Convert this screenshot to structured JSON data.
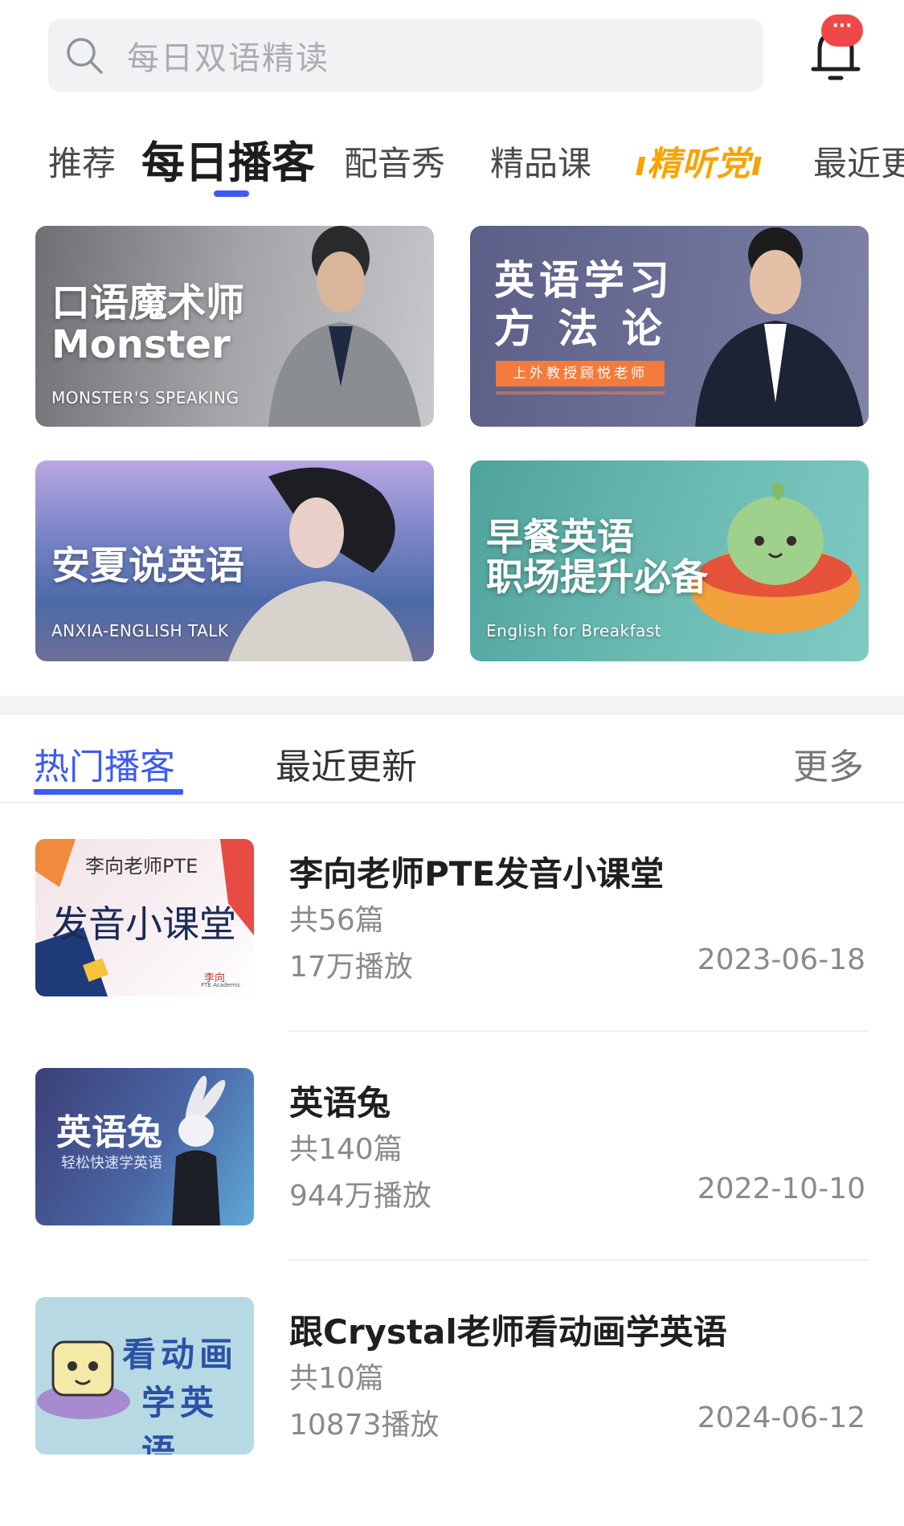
{
  "search": {
    "placeholder": "每日双语精读"
  },
  "notifications": {
    "badge": "···"
  },
  "category_tabs": [
    {
      "label": "推荐",
      "active": false
    },
    {
      "label": "每日播客",
      "active": true
    },
    {
      "label": "配音秀",
      "active": false
    },
    {
      "label": "精品课",
      "active": false
    },
    {
      "label": "精听党",
      "active": false
    },
    {
      "label": "最近更",
      "active": false
    }
  ],
  "banners": [
    {
      "title_line1": "口语魔术师",
      "title_line2": "Monster",
      "subtitle": "MONSTER'S SPEAKING"
    },
    {
      "title_line1": "英语学习",
      "title_line2": "方 法 论",
      "tag": "上外教授顾悦老师"
    },
    {
      "title_line1": "安夏说英语",
      "subtitle": "ANXIA-ENGLISH TALK"
    },
    {
      "title_line1": "早餐英语",
      "title_line2": "职场提升必备",
      "subtitle": "English for Breakfast"
    }
  ],
  "list_tabs": {
    "hot": "热门播客",
    "recent": "最近更新",
    "more": "更多"
  },
  "podcasts": [
    {
      "title": "李向老师PTE发音小课堂",
      "count": "共56篇",
      "plays": "17万播放",
      "date": "2023-06-18",
      "thumb": {
        "top": "李向老师PTE",
        "main": "发音小课堂",
        "logo": "李向",
        "logo_sub": "PTE Academic"
      }
    },
    {
      "title": "英语兔",
      "count": "共140篇",
      "plays": "944万播放",
      "date": "2022-10-10",
      "thumb": {
        "main": "英语兔",
        "sub": "轻松快速学英语"
      }
    },
    {
      "title": "跟Crystal老师看动画学英语",
      "count": "共10篇",
      "plays": "10873播放",
      "date": "2024-06-12",
      "thumb": {
        "line1": "看动画",
        "line2": "学英语"
      }
    }
  ],
  "colors": {
    "accent": "#3d5bf0",
    "badge": "#f04848",
    "special_tab": "#f7a400"
  }
}
